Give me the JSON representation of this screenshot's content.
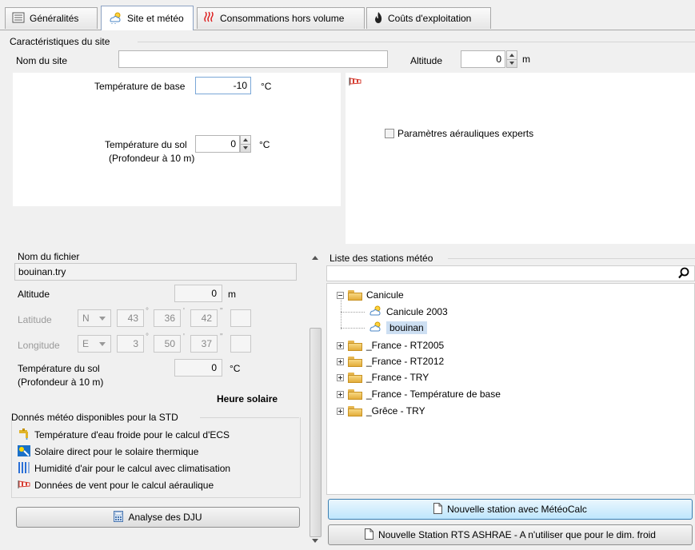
{
  "tabs": [
    {
      "label": "Généralités",
      "icon": "list-icon"
    },
    {
      "label": "Site et météo",
      "icon": "weather-icon"
    },
    {
      "label": "Consommations hors volume",
      "icon": "heater-icon"
    },
    {
      "label": "Coûts d'exploitation",
      "icon": "flame-icon"
    }
  ],
  "site": {
    "section_title": "Caractéristiques du site",
    "name_label": "Nom du site",
    "name_value": "",
    "altitude_label": "Altitude",
    "altitude_value": "0",
    "altitude_unit": "m",
    "base_temp_label": "Température de base",
    "base_temp_value": "-10",
    "base_temp_unit": "°C",
    "ground_temp_label_1": "Température du sol",
    "ground_temp_label_2": "(Profondeur à 10 m)",
    "ground_temp_value": "0",
    "ground_temp_unit": "°C",
    "expert_checkbox_label": "Paramètres aérauliques experts",
    "expert_checked": false
  },
  "file": {
    "name_label": "Nom du fichier",
    "name_value": "bouinan.try",
    "altitude_label": "Altitude",
    "altitude_value": "0",
    "altitude_unit": "m",
    "latitude_label": "Latitude",
    "latitude": {
      "dir": "N",
      "deg": "43",
      "min": "36",
      "sec": "42",
      "extra": ""
    },
    "longitude_label": "Longitude",
    "longitude": {
      "dir": "E",
      "deg": "3",
      "min": "50",
      "sec": "37",
      "extra": ""
    },
    "deg_mark": "°",
    "min_mark": "'",
    "sec_mark": "\"",
    "ground_temp_label_1": "Température du sol",
    "ground_temp_label_2": "(Profondeur à 10 m)",
    "ground_temp_value": "0",
    "ground_temp_unit": "°C",
    "solar_time_label": "Heure solaire"
  },
  "std": {
    "title": "Donnés météo disponibles pour la STD",
    "items": [
      {
        "label": "Température d'eau froide pour le calcul d'ECS",
        "icon": "tap-icon"
      },
      {
        "label": "Solaire direct pour le solaire thermique",
        "icon": "solar-icon"
      },
      {
        "label": "Humidité d'air pour le calcul avec climatisation",
        "icon": "humidity-icon"
      },
      {
        "label": "Données de vent pour le calcul aéraulique",
        "icon": "windsock-icon"
      }
    ]
  },
  "dju_button": "Analyse des DJU",
  "stations": {
    "title": "Liste des stations météo",
    "search_value": "",
    "tree": [
      {
        "label": "Canicule",
        "type": "folder",
        "expanded": true,
        "level": 0
      },
      {
        "label": "Canicule 2003",
        "type": "station",
        "level": 1,
        "selected": false
      },
      {
        "label": "bouinan",
        "type": "station",
        "level": 1,
        "selected": true
      },
      {
        "label": "_France - RT2005",
        "type": "folder",
        "expanded": false,
        "level": 0
      },
      {
        "label": "_France - RT2012",
        "type": "folder",
        "expanded": false,
        "level": 0
      },
      {
        "label": "_France - TRY",
        "type": "folder",
        "expanded": false,
        "level": 0
      },
      {
        "label": "_France - Température de base",
        "type": "folder",
        "expanded": false,
        "level": 0
      },
      {
        "label": "_Grêce - TRY",
        "type": "folder",
        "expanded": false,
        "level": 0
      }
    ]
  },
  "buttons": {
    "new_station": "Nouvelle station avec MétéoCalc",
    "new_rts": "Nouvelle Station RTS ASHRAE - A n'utiliser que pour le dim. froid"
  },
  "colors": {
    "accent": "#3c7fb1",
    "selected_bg": "#cddff2",
    "windsock": "#d63b2f"
  }
}
